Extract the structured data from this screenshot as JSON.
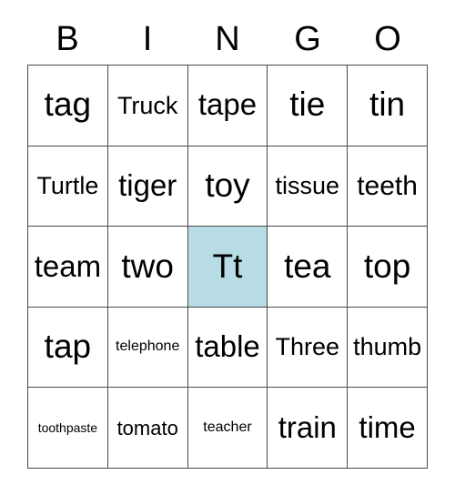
{
  "card": {
    "title": "BINGO Card",
    "free_space_marked": true,
    "marked_color": "#b7dce5",
    "grid_line_color": "#4a4a4a",
    "text_color": "#000000",
    "background_color": "#ffffff"
  },
  "header": {
    "letters": [
      "B",
      "I",
      "N",
      "G",
      "O"
    ]
  },
  "grid": {
    "rows": 5,
    "columns": 5,
    "cells": [
      {
        "text": "tag",
        "marked": false,
        "size": "fs-xxl"
      },
      {
        "text": "Truck",
        "marked": false,
        "size": "fs-m"
      },
      {
        "text": "tape",
        "marked": false,
        "size": "fs-xl"
      },
      {
        "text": "tie",
        "marked": false,
        "size": "fs-xxl"
      },
      {
        "text": "tin",
        "marked": false,
        "size": "fs-xxl"
      },
      {
        "text": "Turtle",
        "marked": false,
        "size": "fs-m"
      },
      {
        "text": "tiger",
        "marked": false,
        "size": "fs-xl"
      },
      {
        "text": "toy",
        "marked": false,
        "size": "fs-xxl"
      },
      {
        "text": "tissue",
        "marked": false,
        "size": "fs-m"
      },
      {
        "text": "teeth",
        "marked": false,
        "size": "fs-l"
      },
      {
        "text": "team",
        "marked": false,
        "size": "fs-xl"
      },
      {
        "text": "two",
        "marked": false,
        "size": "fs-xxl"
      },
      {
        "text": "Tt",
        "marked": true,
        "size": "fs-xxl"
      },
      {
        "text": "tea",
        "marked": false,
        "size": "fs-xxl"
      },
      {
        "text": "top",
        "marked": false,
        "size": "fs-xxl"
      },
      {
        "text": "tap",
        "marked": false,
        "size": "fs-xxl"
      },
      {
        "text": "telephone",
        "marked": false,
        "size": "fs-xs"
      },
      {
        "text": "table",
        "marked": false,
        "size": "fs-xl"
      },
      {
        "text": "Three",
        "marked": false,
        "size": "fs-m"
      },
      {
        "text": "thumb",
        "marked": false,
        "size": "fs-m"
      },
      {
        "text": "toothpaste",
        "marked": false,
        "size": "fs-xxs"
      },
      {
        "text": "tomato",
        "marked": false,
        "size": "fs-s"
      },
      {
        "text": "teacher",
        "marked": false,
        "size": "fs-xs"
      },
      {
        "text": "train",
        "marked": false,
        "size": "fs-xl"
      },
      {
        "text": "time",
        "marked": false,
        "size": "fs-xl"
      }
    ]
  }
}
